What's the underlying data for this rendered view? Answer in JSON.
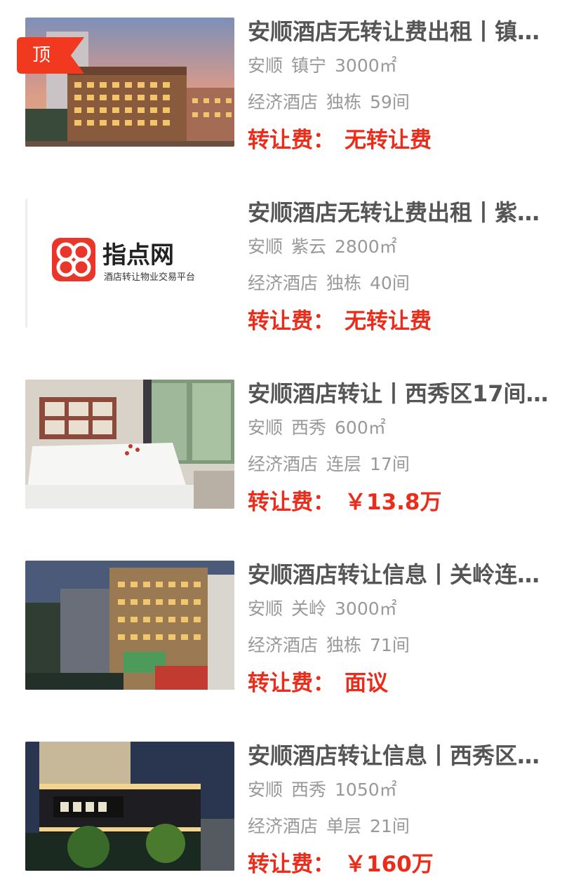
{
  "items": [
    {
      "badge": "顶",
      "title": "安顺酒店无转让费出租丨镇…",
      "city": "安顺",
      "district": "镇宁",
      "area": "3000㎡",
      "type": "经济酒店",
      "form": "独栋",
      "rooms": "59间",
      "fee_label": "转让费：",
      "fee_value": "无转让费",
      "image": "hotel-exterior-dusk"
    },
    {
      "title": "安顺酒店无转让费出租丨紫…",
      "city": "安顺",
      "district": "紫云",
      "area": "2800㎡",
      "type": "经济酒店",
      "form": "独栋",
      "rooms": "40间",
      "fee_label": "转让费：",
      "fee_value": "无转让费",
      "image": "zhidianwang-logo",
      "logo_name": "指点网",
      "logo_tagline": "酒店转让物业交易平台"
    },
    {
      "title": "安顺酒店转让丨西秀区17间…",
      "city": "安顺",
      "district": "西秀",
      "area": "600㎡",
      "type": "经济酒店",
      "form": "连层",
      "rooms": "17间",
      "fee_label": "转让费：",
      "fee_value": "￥13.8万",
      "image": "hotel-bedroom"
    },
    {
      "title": "安顺酒店转让信息丨关岭连…",
      "city": "安顺",
      "district": "关岭",
      "area": "3000㎡",
      "type": "经济酒店",
      "form": "独栋",
      "rooms": "71间",
      "fee_label": "转让费：",
      "fee_value": "面议",
      "image": "hotel-building-evening"
    },
    {
      "title": "安顺酒店转让信息丨西秀区…",
      "city": "安顺",
      "district": "西秀",
      "area": "1050㎡",
      "type": "经济酒店",
      "form": "单层",
      "rooms": "21间",
      "fee_label": "转让费：",
      "fee_value": "￥160万",
      "image": "hotel-street-night"
    }
  ],
  "colors": {
    "accent": "#ec2c1a",
    "title": "#555555",
    "meta": "#999999",
    "badge": "#f0391f"
  }
}
